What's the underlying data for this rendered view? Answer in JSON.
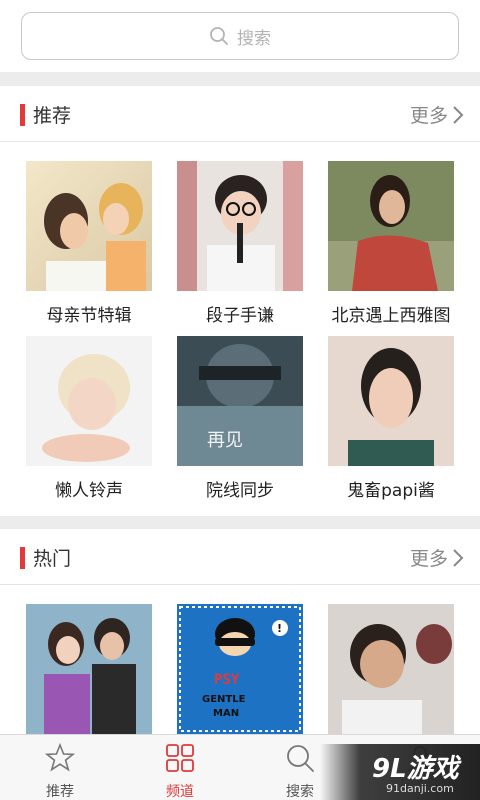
{
  "search": {
    "placeholder": "搜索"
  },
  "recommend": {
    "title": "推荐",
    "more": "更多",
    "items": [
      {
        "label": "母亲节特辑"
      },
      {
        "label": "段子手谦"
      },
      {
        "label": "北京遇上西雅图"
      },
      {
        "label": "懒人铃声"
      },
      {
        "label": "院线同步"
      },
      {
        "label": "鬼畜papi酱"
      }
    ]
  },
  "hot": {
    "title": "热门",
    "more": "更多",
    "items": [
      {
        "label": ""
      },
      {
        "label": "PSY GENTLEMAN"
      },
      {
        "label": ""
      }
    ]
  },
  "tabs": [
    {
      "label": "推荐",
      "icon": "star-icon"
    },
    {
      "label": "频道",
      "icon": "grid-icon",
      "active": true
    },
    {
      "label": "搜索",
      "icon": "search-icon"
    },
    {
      "label": "",
      "icon": "user-icon"
    }
  ],
  "watermark": {
    "brand": "9L游戏",
    "url": "91danji.com"
  },
  "colors": {
    "accent": "#e03a3a"
  }
}
